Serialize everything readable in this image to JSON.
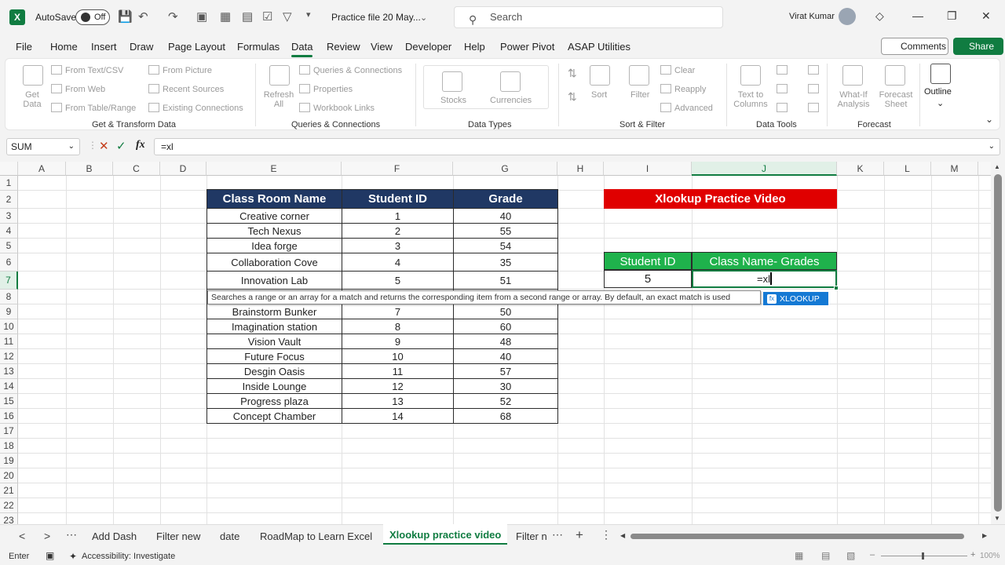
{
  "titlebar": {
    "autosave_label": "AutoSave",
    "toggle_state": "Off",
    "file_name": "Practice file 20 May...",
    "search_placeholder": "Search",
    "user_name": "Virat Kumar"
  },
  "menu": [
    "File",
    "Home",
    "Insert",
    "Draw",
    "Page Layout",
    "Formulas",
    "Data",
    "Review",
    "View",
    "Developer",
    "Help",
    "Power Pivot",
    "ASAP Utilities"
  ],
  "menu_active": "Data",
  "comments_label": "Comments",
  "share_label": "Share",
  "ribbon": {
    "get_data": "Get Data",
    "from_text": "From Text/CSV",
    "from_web": "From Web",
    "from_table": "From Table/Range",
    "from_picture": "From Picture",
    "recent_sources": "Recent Sources",
    "existing_connections": "Existing Connections",
    "group_get_transform": "Get & Transform Data",
    "refresh_all": "Refresh All",
    "queries_connections": "Queries & Connections",
    "properties": "Properties",
    "workbook_links": "Workbook Links",
    "group_queries": "Queries & Connections",
    "stocks": "Stocks",
    "currencies": "Currencies",
    "group_data_types": "Data Types",
    "sort": "Sort",
    "filter": "Filter",
    "clear": "Clear",
    "reapply": "Reapply",
    "advanced": "Advanced",
    "group_sort_filter": "Sort & Filter",
    "text_to_columns": "Text to Columns",
    "group_data_tools": "Data Tools",
    "what_if": "What-If Analysis",
    "forecast_sheet": "Forecast Sheet",
    "group_forecast": "Forecast",
    "outline": "Outline"
  },
  "formula_bar": {
    "name_box": "SUM",
    "formula": "=xl"
  },
  "columns": [
    "A",
    "B",
    "C",
    "D",
    "E",
    "F",
    "G",
    "H",
    "I",
    "J",
    "K",
    "L",
    "M"
  ],
  "rows": [
    "1",
    "2",
    "3",
    "4",
    "5",
    "6",
    "7",
    "8",
    "9",
    "10",
    "11",
    "12",
    "13",
    "14",
    "15",
    "16",
    "17",
    "18",
    "19",
    "20",
    "21",
    "22",
    "23"
  ],
  "table": {
    "headers": [
      "Class Room Name",
      "Student ID",
      "Grade"
    ],
    "rows": [
      [
        "Creative corner",
        "1",
        "40"
      ],
      [
        "Tech Nexus",
        "2",
        "55"
      ],
      [
        "Idea forge",
        "3",
        "54"
      ],
      [
        "Collaboration Cove",
        "4",
        "35"
      ],
      [
        "Innovation Lab",
        "5",
        "51"
      ],
      [
        "",
        "",
        ""
      ],
      [
        "Brainstorm Bunker",
        "7",
        "50"
      ],
      [
        "Imagination station",
        "8",
        "60"
      ],
      [
        "Vision Vault",
        "9",
        "48"
      ],
      [
        "Future Focus",
        "10",
        "40"
      ],
      [
        "Desgin Oasis",
        "11",
        "57"
      ],
      [
        "Inside Lounge",
        "12",
        "30"
      ],
      [
        "Progress plaza",
        "13",
        "52"
      ],
      [
        "Concept Chamber",
        "14",
        "68"
      ]
    ]
  },
  "lookup": {
    "title": "Xlookup Practice Video",
    "hdr_student_id": "Student ID",
    "hdr_class_grades": "Class Name- Grades",
    "student_id_value": "5",
    "active_cell_text": "=xl"
  },
  "tooltip": "Searches a range or an array for a match and returns the corresponding item from a second range or array. By default, an exact match is used",
  "suggestion": "XLOOKUP",
  "sheets": [
    "Add Dash",
    "Filter new",
    "date",
    "RoadMap to Learn Excel",
    "Xlookup practice video",
    "Filter n"
  ],
  "active_sheet": "Xlookup practice video",
  "status": {
    "mode": "Enter",
    "accessibility": "Accessibility: Investigate",
    "zoom": "100%"
  }
}
